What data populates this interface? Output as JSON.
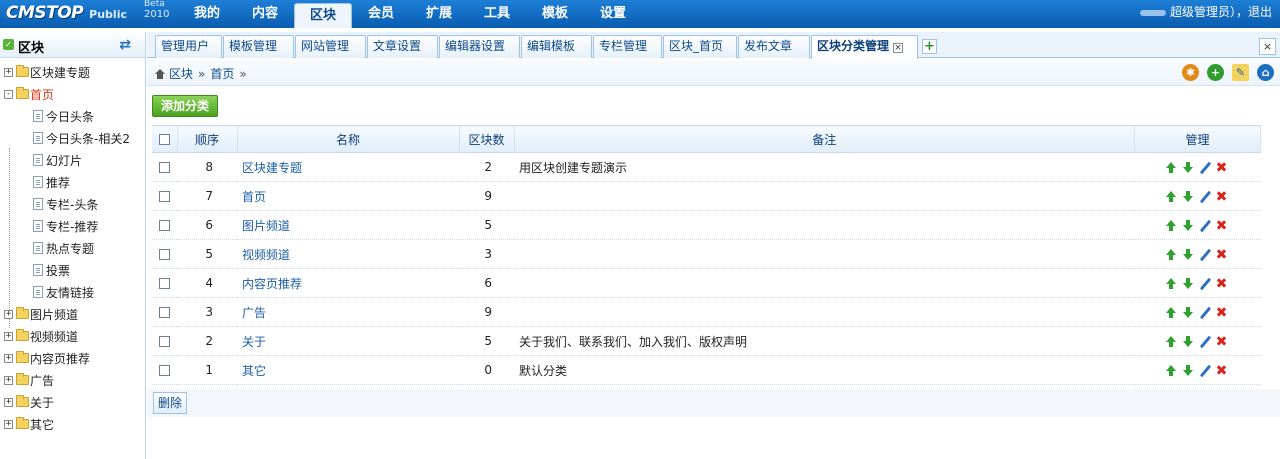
{
  "header": {
    "logo_text": "CMSTOP",
    "logo_sub": "Public",
    "logo_beta": "Beta",
    "logo_year": "2010",
    "nav": [
      "我的",
      "内容",
      "区块",
      "会员",
      "扩展",
      "工具",
      "模板",
      "设置"
    ],
    "active_nav": "区块",
    "user_text": "超级管理员），退出"
  },
  "sidebar": {
    "title": "区块",
    "refresh_icon": "refresh-icon",
    "tree": [
      {
        "label": "区块建专题",
        "type": "folder",
        "expand": "+"
      },
      {
        "label": "首页",
        "type": "folder",
        "expand": "-",
        "open": true
      },
      {
        "label": "今日头条",
        "type": "page"
      },
      {
        "label": "今日头条-相关2",
        "type": "page"
      },
      {
        "label": "幻灯片",
        "type": "page"
      },
      {
        "label": "推荐",
        "type": "page"
      },
      {
        "label": "专栏-头条",
        "type": "page"
      },
      {
        "label": "专栏-推荐",
        "type": "page"
      },
      {
        "label": "热点专题",
        "type": "page"
      },
      {
        "label": "投票",
        "type": "page"
      },
      {
        "label": "友情链接",
        "type": "page"
      },
      {
        "label": "图片频道",
        "type": "folder",
        "expand": "+"
      },
      {
        "label": "视频频道",
        "type": "folder",
        "expand": "+"
      },
      {
        "label": "内容页推荐",
        "type": "folder",
        "expand": "+"
      },
      {
        "label": "广告",
        "type": "folder",
        "expand": "+"
      },
      {
        "label": "关于",
        "type": "folder",
        "expand": "+"
      },
      {
        "label": "其它",
        "type": "folder",
        "expand": "+"
      }
    ]
  },
  "tabs": {
    "items": [
      "管理用户",
      "模板管理",
      "网站管理",
      "文章设置",
      "编辑器设置",
      "编辑模板",
      "专栏管理",
      "区块_首页",
      "发布文章",
      "区块分类管理"
    ],
    "active": "区块分类管理",
    "close_glyph": "×",
    "add_glyph": "+",
    "window_close_glyph": "×"
  },
  "breadcrumb": {
    "items": [
      "区块",
      "首页"
    ],
    "separator": "»"
  },
  "toolbar_icons": [
    "bug-icon",
    "add-icon",
    "edit-icon",
    "home-icon"
  ],
  "actions": {
    "add_category": "添加分类",
    "delete": "删除"
  },
  "table": {
    "headers": {
      "order": "顺序",
      "name": "名称",
      "count": "区块数",
      "note": "备注",
      "manage": "管理"
    },
    "rows": [
      {
        "order": "8",
        "name": "区块建专题",
        "count": "2",
        "note": "用区块创建专题演示"
      },
      {
        "order": "7",
        "name": "首页",
        "count": "9",
        "note": ""
      },
      {
        "order": "6",
        "name": "图片频道",
        "count": "5",
        "note": ""
      },
      {
        "order": "5",
        "name": "视频频道",
        "count": "3",
        "note": ""
      },
      {
        "order": "4",
        "name": "内容页推荐",
        "count": "6",
        "note": ""
      },
      {
        "order": "3",
        "name": "广告",
        "count": "9",
        "note": ""
      },
      {
        "order": "2",
        "name": "关于",
        "count": "5",
        "note": "关于我们、联系我们、加入我们、版权声明"
      },
      {
        "order": "1",
        "name": "其它",
        "count": "0",
        "note": "默认分类"
      }
    ]
  },
  "colors": {
    "topbar": "#0a5cb0",
    "accent": "#1d5fa8",
    "add_button": "#4aa21e",
    "delete_icon": "#d8241a",
    "move_icon": "#2ea12e"
  }
}
